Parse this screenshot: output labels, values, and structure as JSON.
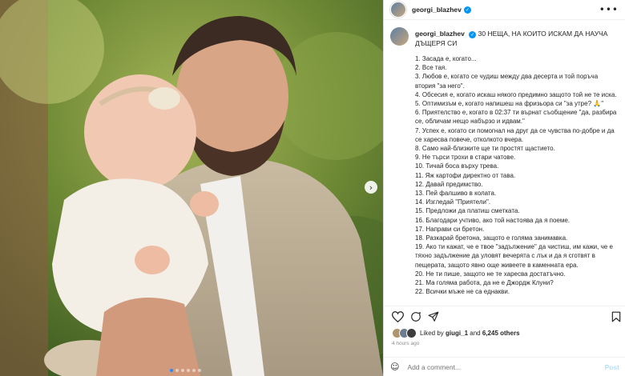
{
  "post": {
    "username": "georgi_blazhev",
    "verified_mark": "✓",
    "more_icon": "more-icon"
  },
  "caption": {
    "username": "georgi_blazhev",
    "title": "30 НЕЩА, НА КОИТО ИСКАМ ДА НАУЧА ДЪЩЕРЯ СИ",
    "items": [
      "1. Засада е, когато...",
      "2. Все тая.",
      "3. Любов е, когато се чудиш между два десерта и той поръча втория \"за него\".",
      "4. Обсесия е, когато искаш някого предимно защото той не те иска.",
      "5. Оптимизъм е, когато напишеш на фризьора си \"за утре? 🙏\"",
      "6. Приятелство е, когато в 02:37 ти върнат съобщение \"да, разбира се, обличам нещо набързо и идвам.\"",
      "7. Успех е, когато си помогнал на друг да се чувства по-добре и да се харесва повече, отколкото вчера.",
      "8. Само най-близките ще ти простят щастието.",
      "9. Не търси трохи в стари чатове.",
      "10. Тичай боса върху трева.",
      "11. Яж картофи директно от тава.",
      "12. Давай предимство.",
      "13. Пей фалшиво в колата.",
      "14. Изгледай \"Приятели\".",
      "15. Предложи да платиш сметката.",
      "16. Благодари учтиво, ако той настоява да я поеме.",
      "17. Направи си бретон.",
      "18. Разкарай бретона, защото е голяма занимавка.",
      "19. Ако ти кажат, че е твое \"задължение\" да чистиш, им кажи, че е тяхно задължение да уловят вечерята с лък и да я сготвят в пещерата, защото явно още живеете в каменната ера.",
      "20. Не ти пише, защото не те харесва достатъчно.",
      "21. Ма голяма работа, да не е Джордж Клуни?",
      "22. Всички мъже не са еднакви."
    ]
  },
  "likes": {
    "prefix": "Liked by",
    "user": "giugi_1",
    "and": "and",
    "others": "6,245 others"
  },
  "time": "4 hours ago",
  "comment": {
    "emoji": "☺",
    "placeholder": "Add a comment...",
    "post_label": "Post"
  },
  "carousel": {
    "next_icon": "›",
    "slide_count": 6,
    "active_index": 0
  }
}
